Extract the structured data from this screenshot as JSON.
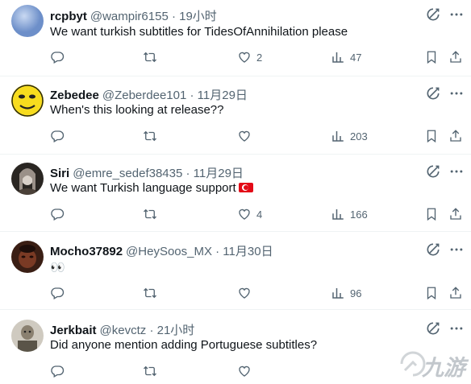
{
  "tweets": [
    {
      "name": "rcpbyt",
      "handle": "@wampir6155 · 19小时",
      "text": "We want turkish subtitles for TidesOfAnnihilation please",
      "replies": "",
      "retweets": "",
      "likes": "2",
      "views": "47"
    },
    {
      "name": "Zebedee",
      "handle": "@Zeberdee101 · 11月29日",
      "text": "When's this looking at release??",
      "replies": "",
      "retweets": "",
      "likes": "",
      "views": "203"
    },
    {
      "name": "Siri",
      "handle": "@emre_sedef38435 · 11月29日",
      "text": "We want Turkish language support",
      "replies": "",
      "retweets": "",
      "likes": "4",
      "views": "166"
    },
    {
      "name": "Mocho37892",
      "handle": "@HeySoos_MX · 11月30日",
      "text": "👀",
      "replies": "",
      "retweets": "",
      "likes": "",
      "views": "96"
    },
    {
      "name": "Jerkbait",
      "handle": "@kevctz · 21小时",
      "text": "Did anyone mention adding Portuguese subtitles?",
      "replies": "",
      "retweets": "",
      "likes": "",
      "views": ""
    }
  ],
  "watermark": {
    "text": "九游"
  },
  "icons": {
    "grok": "grok-icon",
    "more": "more-icon",
    "reply": "reply-icon",
    "retweet": "retweet-icon",
    "like": "heart-icon",
    "views": "views-icon",
    "bookmark": "bookmark-icon",
    "share": "share-icon"
  },
  "colors": {
    "text": "#0f1419",
    "secondary": "#536471",
    "divider": "#eff3f4",
    "flag_red": "#e30a17"
  }
}
